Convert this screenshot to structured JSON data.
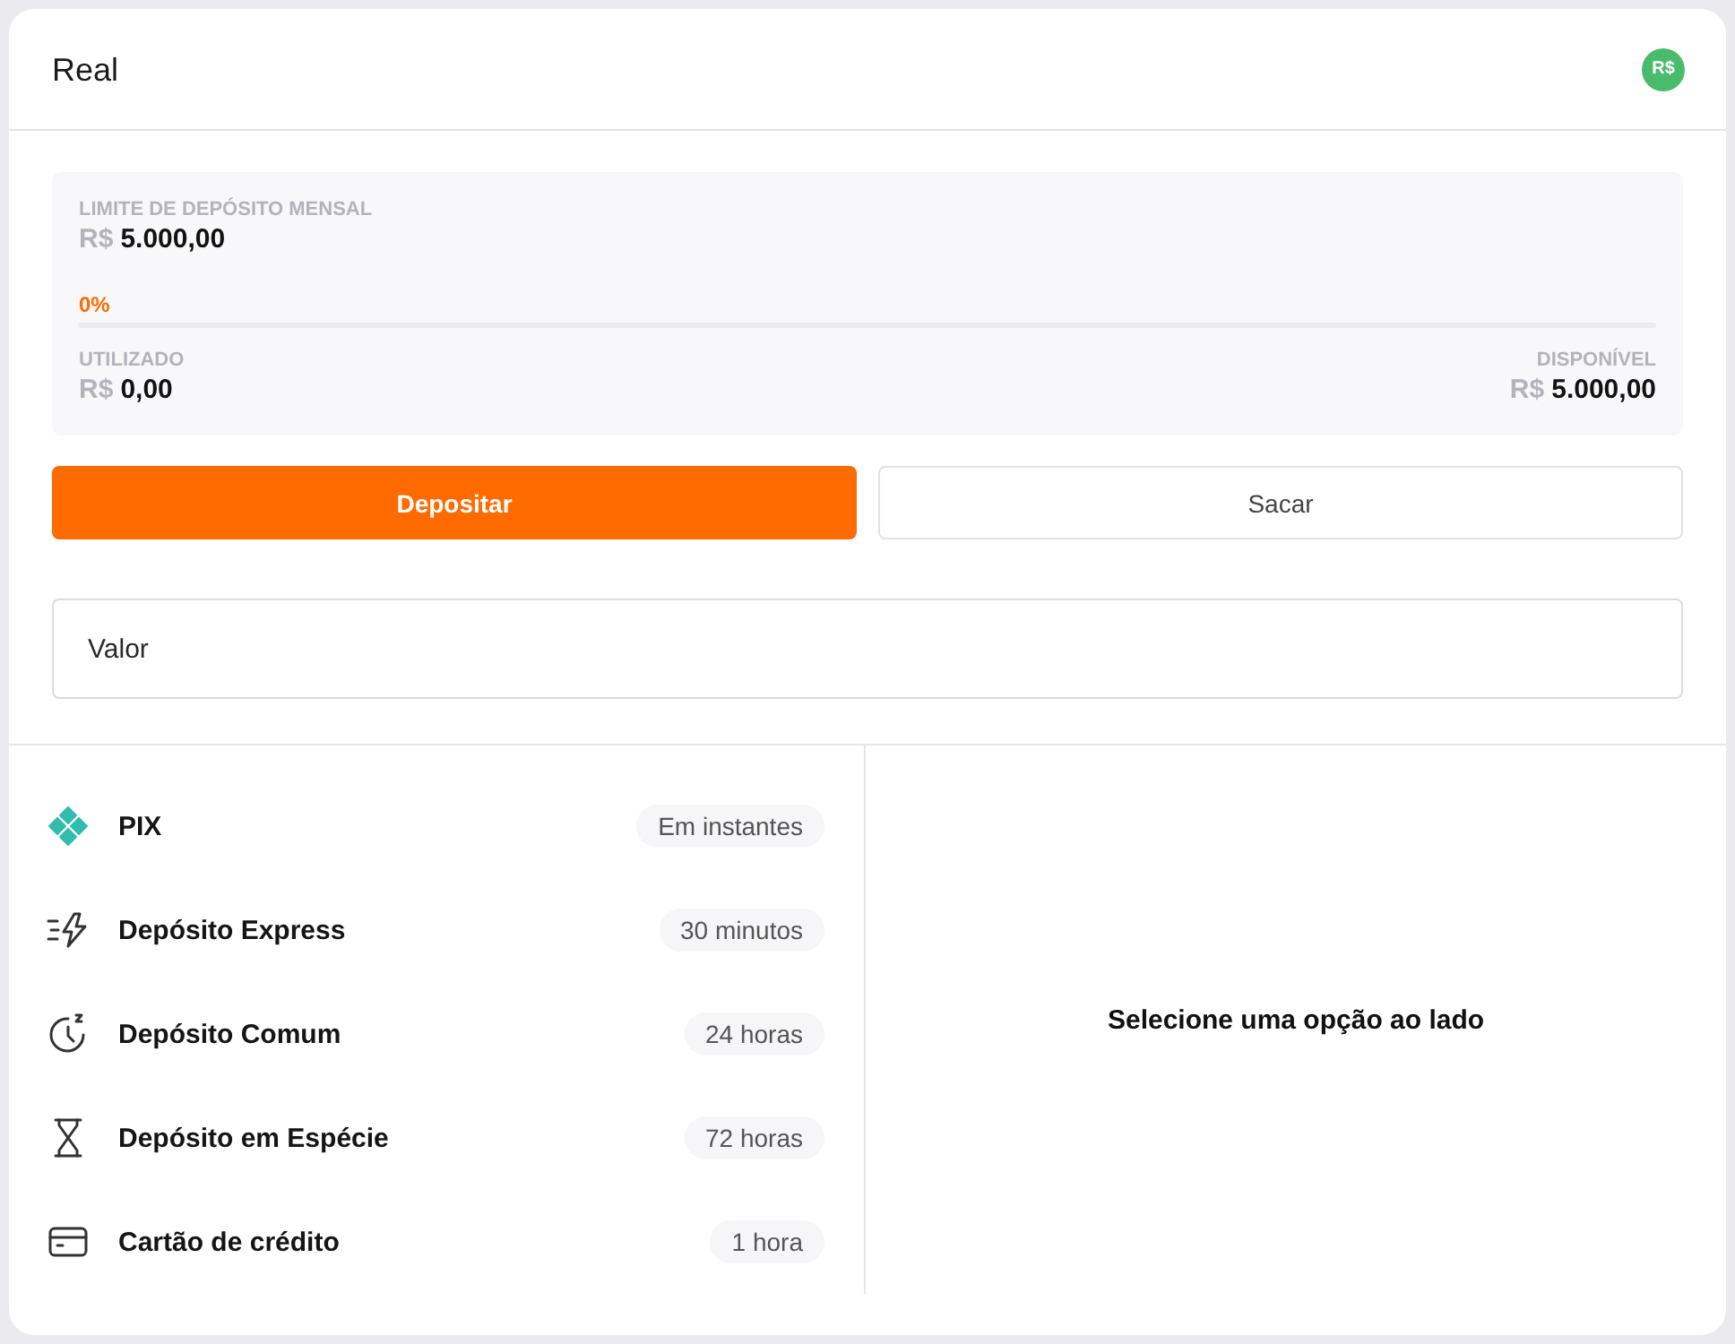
{
  "header": {
    "title": "Real",
    "currency_badge": "R$"
  },
  "limit_panel": {
    "title": "LIMITE DE DEPÓSITO MENSAL",
    "limit": {
      "currency": "R$",
      "amount": "5.000,00"
    },
    "percent": "0%",
    "progress": {
      "level": 0
    },
    "used": {
      "label": "UTILIZADO",
      "currency": "R$",
      "amount": "0,00"
    },
    "available": {
      "label": "DISPONÍVEL",
      "currency": "R$",
      "amount": "5.000,00"
    }
  },
  "actions": [
    {
      "label": "Depositar",
      "selected": true
    },
    {
      "label": "Sacar",
      "selected": false
    }
  ],
  "amount_field": {
    "placeholder": "Valor"
  },
  "methods": [
    {
      "name": "PIX",
      "time": "Em instantes"
    },
    {
      "name": "Depósito Express",
      "time": "30 minutos"
    },
    {
      "name": "Depósito Comum",
      "time": "24 horas"
    },
    {
      "name": "Depósito em Espécie",
      "time": "72 horas"
    },
    {
      "name": "Cartão de crédito",
      "time": "1 hora"
    }
  ],
  "detail_panel": {
    "message": "Selecione uma opção ao lado"
  }
}
